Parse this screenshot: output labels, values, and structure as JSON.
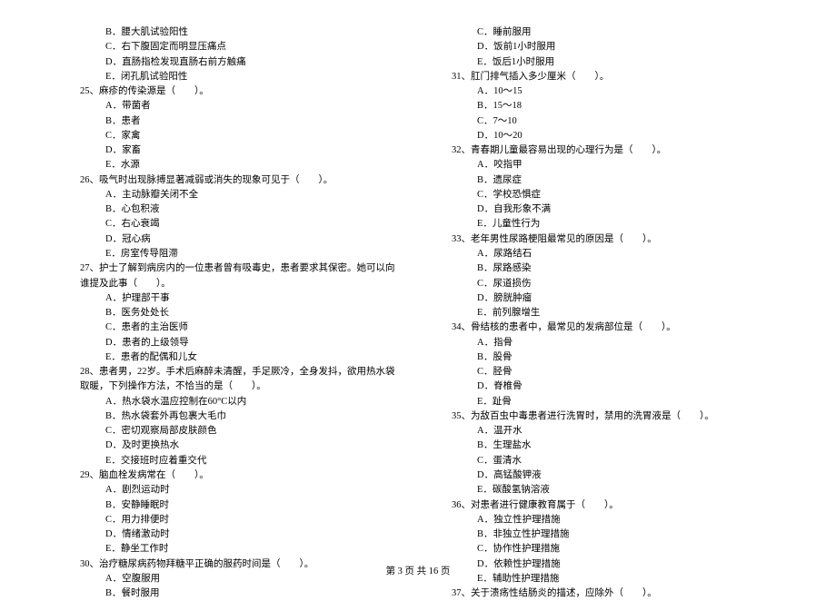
{
  "left": {
    "orphan_opts": [
      "B．腰大肌试验阳性",
      "C．右下腹固定而明显压痛点",
      "D．直肠指检发现直肠右前方触痛",
      "E．闭孔肌试验阳性"
    ],
    "questions": [
      {
        "head": "25、麻疹的传染源是（　　）。",
        "opts": [
          "A．带菌者",
          "B．患者",
          "C．家禽",
          "D．家畜",
          "E．水源"
        ]
      },
      {
        "head": "26、吸气时出现脉搏显著减弱或消失的现象可见于（　　）。",
        "opts": [
          "A．主动脉瓣关闭不全",
          "B．心包积液",
          "C．右心衰竭",
          "D．冠心病",
          "E．房室传导阻滞"
        ]
      },
      {
        "head": "27、护士了解到病房内的一位患者曾有吸毒史，患者要求其保密。她可以向谁提及此事（　　）。",
        "opts": [
          "A．护理部干事",
          "B．医务处处长",
          "C．患者的主治医师",
          "D．患者的上级领导",
          "E．患者的配偶和儿女"
        ]
      },
      {
        "head": "28、患者男，22岁。手术后麻醉未清醒，手足厥冷，全身发抖，欲用热水袋取暖，下列操作方法，不恰当的是（　　）。",
        "opts": [
          "A．热水袋水温应控制在60°C以内",
          "B．热水袋套外再包裹大毛巾",
          "C．密切观察局部皮肤颜色",
          "D．及时更换热水",
          "E．交接班时应着重交代"
        ]
      },
      {
        "head": "29、脑血栓发病常在（　　）。",
        "opts": [
          "A．剧烈运动时",
          "B．安静睡眠时",
          "C．用力排便时",
          "D．情绪激动时",
          "E．静坐工作时"
        ]
      },
      {
        "head": "30、治疗糖尿病药物拜糖平正确的服药时间是（　　）。",
        "opts": [
          "A．空腹服用",
          "B．餐时服用"
        ]
      }
    ]
  },
  "right": {
    "orphan_opts": [
      "C．睡前服用",
      "D．饭前1小时服用",
      "E．饭后1小时服用"
    ],
    "questions": [
      {
        "head": "31、肛门排气插入多少厘米（　　）。",
        "opts": [
          "A．10～15",
          "B．15～18",
          "C．7～10",
          "D．10～20"
        ]
      },
      {
        "head": "32、青春期儿童最容易出现的心理行为是（　　）。",
        "opts": [
          "A．咬指甲",
          "B．遗尿症",
          "C．学校恐惧症",
          "D．自我形象不满",
          "E．儿童性行为"
        ]
      },
      {
        "head": "33、老年男性尿路梗阻最常见的原因是（　　）。",
        "opts": [
          "A．尿路结石",
          "B．尿路感染",
          "C．尿道损伤",
          "D．膀胱肿瘤",
          "E．前列腺增生"
        ]
      },
      {
        "head": "34、骨结核的患者中，最常见的发病部位是（　　）。",
        "opts": [
          "A．指骨",
          "B．股骨",
          "C．胫骨",
          "D．脊椎骨",
          "E．趾骨"
        ]
      },
      {
        "head": "35、为敌百虫中毒患者进行洗胃时，禁用的洗胃液是（　　）。",
        "opts": [
          "A．温开水",
          "B．生理盐水",
          "C．蛋清水",
          "D．高锰酸钾液",
          "E．碳酸氢钠溶液"
        ]
      },
      {
        "head": "36、对患者进行健康教育属于（　　）。",
        "opts": [
          "A．独立性护理措施",
          "B．非独立性护理措施",
          "C．协作性护理措施",
          "D．依赖性护理措施",
          "E．辅助性护理措施"
        ]
      },
      {
        "head": "37、关于溃疡性结肠炎的描述，应除外（　　）。",
        "opts": []
      }
    ]
  },
  "footer": "第 3 页 共 16 页"
}
